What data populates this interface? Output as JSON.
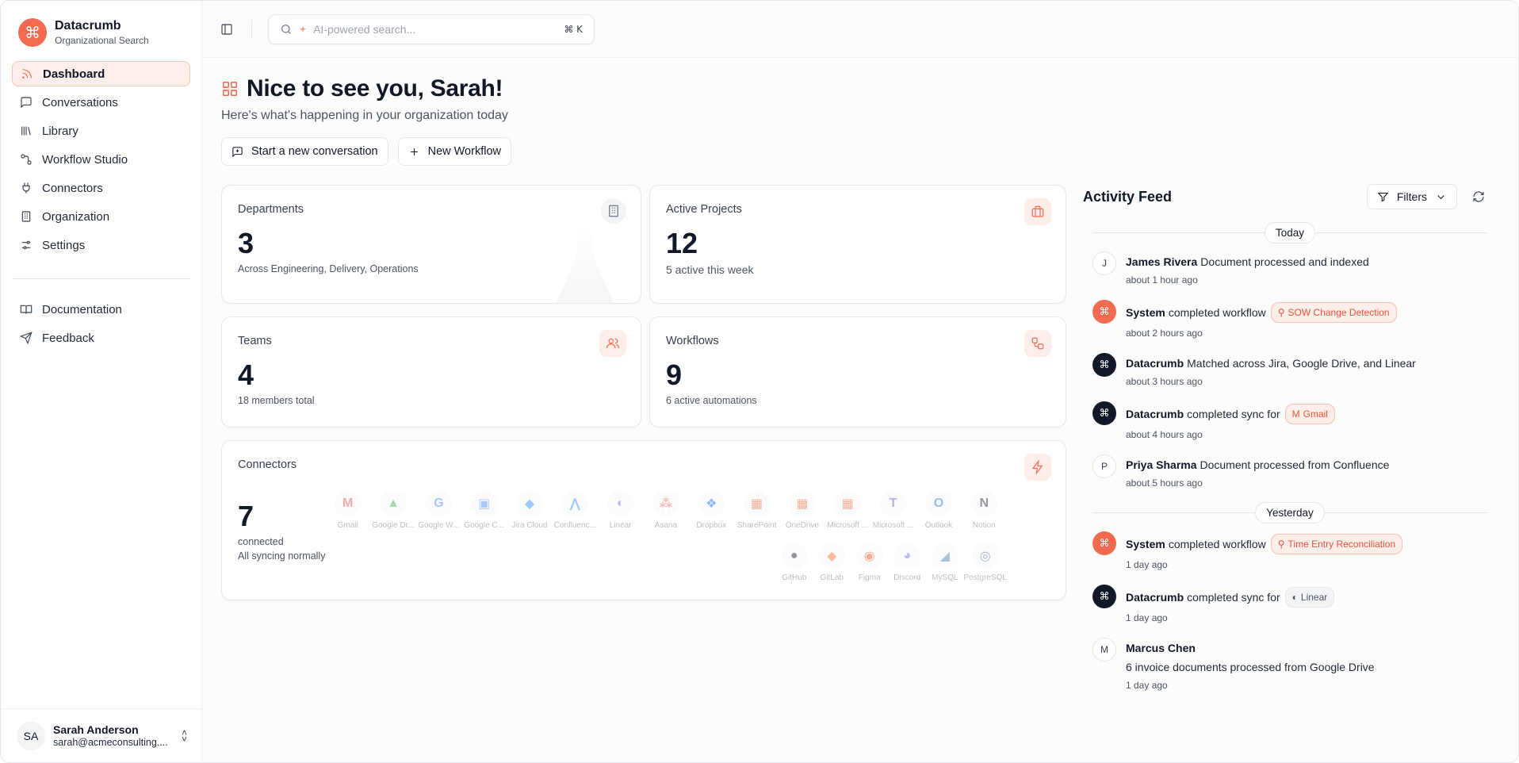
{
  "brand": {
    "name": "Datacrumb",
    "subtitle": "Organizational Search",
    "logo_icon": "command-icon"
  },
  "sidebar": {
    "items": [
      {
        "label": "Dashboard",
        "icon": "rss-icon",
        "active": true
      },
      {
        "label": "Conversations",
        "icon": "message-square-icon"
      },
      {
        "label": "Library",
        "icon": "library-icon"
      },
      {
        "label": "Workflow Studio",
        "icon": "workflow-icon"
      },
      {
        "label": "Connectors",
        "icon": "plug-icon"
      },
      {
        "label": "Organization",
        "icon": "building-icon"
      },
      {
        "label": "Settings",
        "icon": "sliders-icon"
      }
    ],
    "secondary": [
      {
        "label": "Documentation",
        "icon": "book-icon"
      },
      {
        "label": "Feedback",
        "icon": "send-icon"
      }
    ],
    "user": {
      "initials": "SA",
      "name": "Sarah Anderson",
      "email": "sarah@acmeconsulting...."
    }
  },
  "topbar": {
    "search_placeholder": "AI-powered search...",
    "shortcut": "⌘ K"
  },
  "header": {
    "title": "Nice to see you, Sarah!",
    "subtitle": "Here's what's happening in your organization today",
    "actions": {
      "new_conversation": "Start a new conversation",
      "new_workflow": "New Workflow"
    }
  },
  "stats": {
    "departments": {
      "title": "Departments",
      "value": "3",
      "note": "Across Engineering, Delivery, Operations"
    },
    "projects": {
      "title": "Active Projects",
      "value": "12",
      "note": "5 active this week"
    },
    "teams": {
      "title": "Teams",
      "value": "4",
      "note": "18 members total"
    },
    "workflows": {
      "title": "Workflows",
      "value": "9",
      "note": "6 active automations"
    },
    "connectors": {
      "title": "Connectors",
      "value": "7",
      "note1": "connected",
      "note2": "All syncing normally"
    }
  },
  "connector_logos": {
    "row1": [
      {
        "name": "Gmail",
        "glyph": "M",
        "color": "#ea4335"
      },
      {
        "name": "Google Dr...",
        "glyph": "▲",
        "color": "#34a853"
      },
      {
        "name": "Google W...",
        "glyph": "G",
        "color": "#4285f4"
      },
      {
        "name": "Google C...",
        "glyph": "▣",
        "color": "#4285f4"
      },
      {
        "name": "Jira Cloud",
        "glyph": "◆",
        "color": "#2684ff"
      },
      {
        "name": "Confluenc...",
        "glyph": "⋀",
        "color": "#2684ff"
      },
      {
        "name": "Linear",
        "glyph": "◐",
        "color": "#5e6ad2"
      },
      {
        "name": "Asana",
        "glyph": "⁂",
        "color": "#f06a6a"
      },
      {
        "name": "Dropbox",
        "glyph": "❖",
        "color": "#0061ff"
      },
      {
        "name": "SharePoint",
        "glyph": "▦",
        "color": "#f25022"
      },
      {
        "name": "OneDrive",
        "glyph": "▦",
        "color": "#f25022"
      },
      {
        "name": "Microsoft ...",
        "glyph": "▦",
        "color": "#f25022"
      },
      {
        "name": "Microsoft ...",
        "glyph": "T",
        "color": "#5059c9"
      },
      {
        "name": "Outlook",
        "glyph": "O",
        "color": "#0078d4"
      },
      {
        "name": "Notion",
        "glyph": "N",
        "color": "#111827"
      }
    ],
    "row2": [
      {
        "name": "GitHub",
        "glyph": "●",
        "color": "#111827"
      },
      {
        "name": "GitLab",
        "glyph": "◆",
        "color": "#fc6d26"
      },
      {
        "name": "Figma",
        "glyph": "◉",
        "color": "#f24e1e"
      },
      {
        "name": "Discord",
        "glyph": "◕",
        "color": "#5865f2"
      },
      {
        "name": "MySQL",
        "glyph": "◢",
        "color": "#4479a1"
      },
      {
        "name": "PostgreSQL",
        "glyph": "◎",
        "color": "#336791"
      }
    ]
  },
  "feed": {
    "title": "Activity Feed",
    "filters_label": "Filters",
    "groups": [
      {
        "day": "Today",
        "items": [
          {
            "avatar": "J",
            "style": "letter",
            "actor": "James Rivera",
            "text": "Document processed and indexed",
            "tag": "",
            "time": "about 1 hour ago"
          },
          {
            "avatar": "⌘",
            "style": "orange",
            "actor": "System",
            "text": "completed workflow",
            "tag": "SOW Change Detection",
            "tag_style": "orange",
            "time": "about 2 hours ago"
          },
          {
            "avatar": "⌘",
            "style": "dark",
            "actor": "Datacrumb",
            "text": "Matched across Jira, Google Drive, and Linear",
            "tag": "",
            "time": "about 3 hours ago"
          },
          {
            "avatar": "⌘",
            "style": "dark",
            "actor": "Datacrumb",
            "text": "completed sync for",
            "tag": "Gmail",
            "tag_style": "orange",
            "time": "about 4 hours ago"
          },
          {
            "avatar": "P",
            "style": "letter",
            "actor": "Priya Sharma",
            "text": "Document processed from Confluence",
            "tag": "",
            "time": "about 5 hours ago"
          }
        ]
      },
      {
        "day": "Yesterday",
        "items": [
          {
            "avatar": "⌘",
            "style": "orange",
            "actor": "System",
            "text": "completed workflow",
            "tag": "Time Entry Reconciliation",
            "tag_style": "orange",
            "time": "1 day ago"
          },
          {
            "avatar": "⌘",
            "style": "dark",
            "actor": "Datacrumb",
            "text": "completed sync for",
            "tag": "Linear",
            "tag_style": "gray",
            "time": "1 day ago"
          },
          {
            "avatar": "M",
            "style": "letter",
            "actor": "Marcus Chen",
            "text": "6 invoice documents processed from Google Drive",
            "tag": "",
            "time": "1 day ago",
            "block": true
          }
        ]
      }
    ]
  },
  "colors": {
    "accent": "#f26a4f",
    "accent_soft": "#fdeee9",
    "dark": "#111827"
  }
}
